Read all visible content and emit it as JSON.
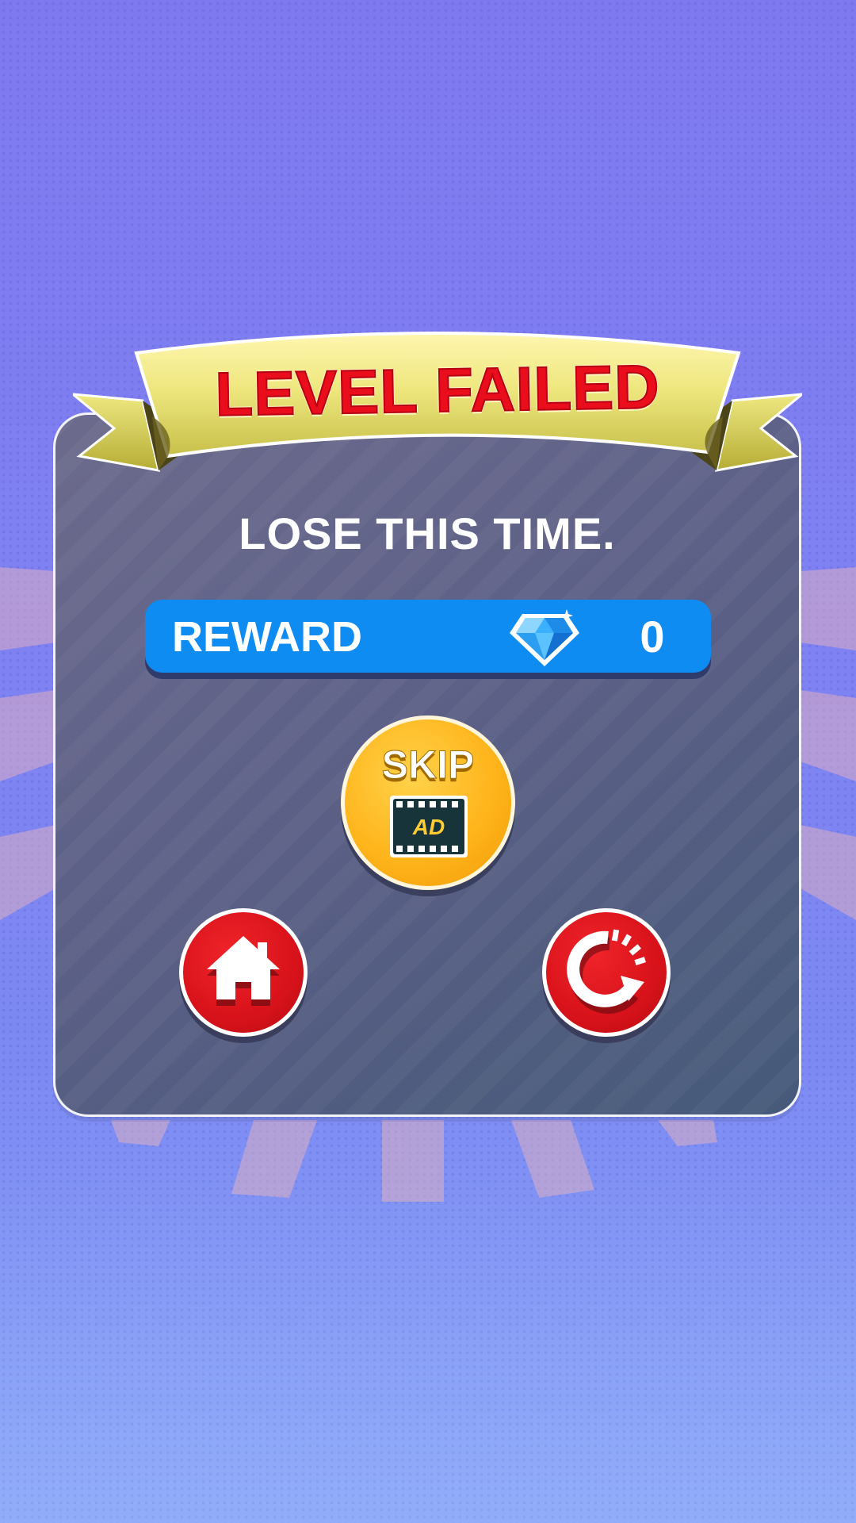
{
  "banner": {
    "title": "LEVEL FAILED"
  },
  "message": {
    "text": "LOSE THIS TIME."
  },
  "reward": {
    "label": "REWARD",
    "value": "0",
    "icon": "diamond-icon"
  },
  "skip": {
    "label": "SKIP",
    "ad_label": "AD",
    "icon": "film-ad-icon"
  },
  "buttons": {
    "home_icon": "home-icon",
    "restart_icon": "restart-icon"
  },
  "colors": {
    "background": "#7f82f2",
    "panel": "#5b5f86",
    "title_red": "#ea0e1d",
    "ribbon_gold": "#e2dc6a",
    "reward_blue": "#0f8cf2",
    "skip_orange": "#ffb51c",
    "button_red": "#d8121a"
  }
}
